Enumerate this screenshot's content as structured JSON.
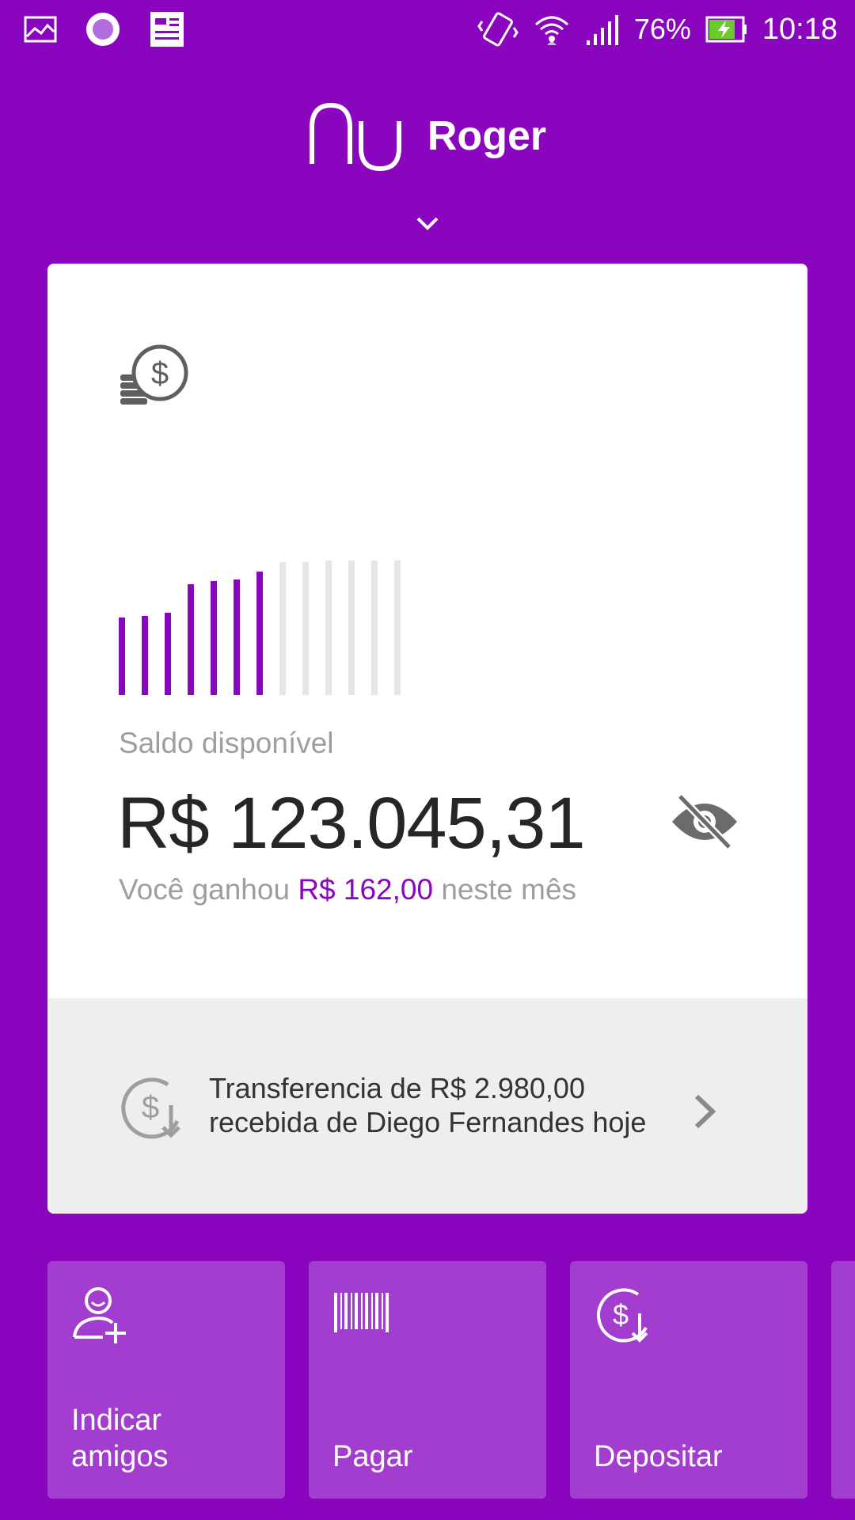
{
  "status_bar": {
    "battery": "76%",
    "time": "10:18"
  },
  "header": {
    "user_name": "Roger"
  },
  "account": {
    "balance_label": "Saldo disponível",
    "balance_value": "R$ 123.045,31",
    "earned_prefix": "Você ganhou",
    "earned_amount": "R$ 162,00",
    "earned_suffix": "neste mês",
    "history_bars": {
      "active_count": 7,
      "total_count": 13
    }
  },
  "notification": {
    "line1": "Transferencia de R$ 2.980,00",
    "line2": "recebida de Diego Fernandes hoje"
  },
  "shortcuts": [
    {
      "label_line1": "Indicar",
      "label_line2": "amigos",
      "icon": "add-person-icon"
    },
    {
      "label_line1": "",
      "label_line2": "Pagar",
      "icon": "barcode-icon"
    },
    {
      "label_line1": "",
      "label_line2": "Depositar",
      "icon": "deposit-icon"
    }
  ],
  "colors": {
    "brand": "#8a05be",
    "tile": "#a33dd0"
  }
}
